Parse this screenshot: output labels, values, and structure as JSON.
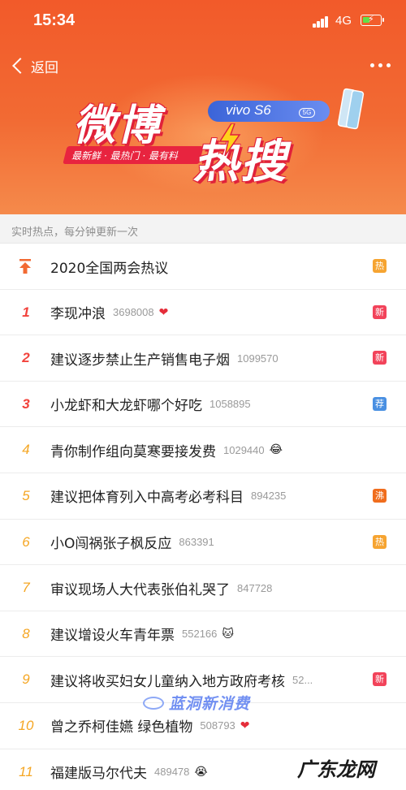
{
  "status_bar": {
    "time": "15:34",
    "network": "4G"
  },
  "nav": {
    "back_label": "返回"
  },
  "banner": {
    "title_part1": "微博",
    "title_part2": "热搜",
    "slogan": "最新鲜 · 最热门 · 最有料",
    "brand": "vivo S6",
    "brand_badge": "5G"
  },
  "section_header": "实时热点，每分钟更新一次",
  "items": [
    {
      "rank": "",
      "topic": "2020全国两会热议",
      "count": "",
      "emoji": "",
      "tag": "热",
      "tag_type": "hot"
    },
    {
      "rank": "1",
      "topic": "李现冲浪",
      "count": "3698008",
      "emoji": "❤",
      "tag": "新",
      "tag_type": "new"
    },
    {
      "rank": "2",
      "topic": "建议逐步禁止生产销售电子烟",
      "count": "1099570",
      "emoji": "",
      "tag": "新",
      "tag_type": "new"
    },
    {
      "rank": "3",
      "topic": "小龙虾和大龙虾哪个好吃",
      "count": "1058895",
      "emoji": "",
      "tag": "荐",
      "tag_type": "rec"
    },
    {
      "rank": "4",
      "topic": "青你制作组向莫寒要接发费",
      "count": "1029440",
      "emoji": "😂",
      "tag": "",
      "tag_type": ""
    },
    {
      "rank": "5",
      "topic": "建议把体育列入中高考必考科目",
      "count": "894235",
      "emoji": "",
      "tag": "沸",
      "tag_type": "boil"
    },
    {
      "rank": "6",
      "topic": "小O闯祸张子枫反应",
      "count": "863391",
      "emoji": "",
      "tag": "热",
      "tag_type": "hot"
    },
    {
      "rank": "7",
      "topic": "审议现场人大代表张伯礼哭了",
      "count": "847728",
      "emoji": "",
      "tag": "",
      "tag_type": ""
    },
    {
      "rank": "8",
      "topic": "建议增设火车青年票",
      "count": "552166",
      "emoji": "🐱",
      "tag": "",
      "tag_type": ""
    },
    {
      "rank": "9",
      "topic": "建议将收买妇女儿童纳入地方政府考核",
      "count": "52...",
      "emoji": "",
      "tag": "新",
      "tag_type": "new"
    },
    {
      "rank": "10",
      "topic": "曾之乔柯佳嬿 绿色植物",
      "count": "508793",
      "emoji": "❤",
      "tag": "",
      "tag_type": ""
    },
    {
      "rank": "11",
      "topic": "福建版马尔代夫",
      "count": "489478",
      "emoji": "😭",
      "tag": "",
      "tag_type": ""
    }
  ],
  "watermarks": {
    "center": "蓝洞新消费",
    "corner": "广东龙网"
  },
  "colors": {
    "header_bg": "#f25a2a",
    "rank_top3": "#f2433c",
    "rank_rest": "#f5a623",
    "tag_hot": "#f6a431",
    "tag_new": "#f2435a",
    "tag_rec": "#4a90e2",
    "tag_boil": "#f06d1d"
  }
}
